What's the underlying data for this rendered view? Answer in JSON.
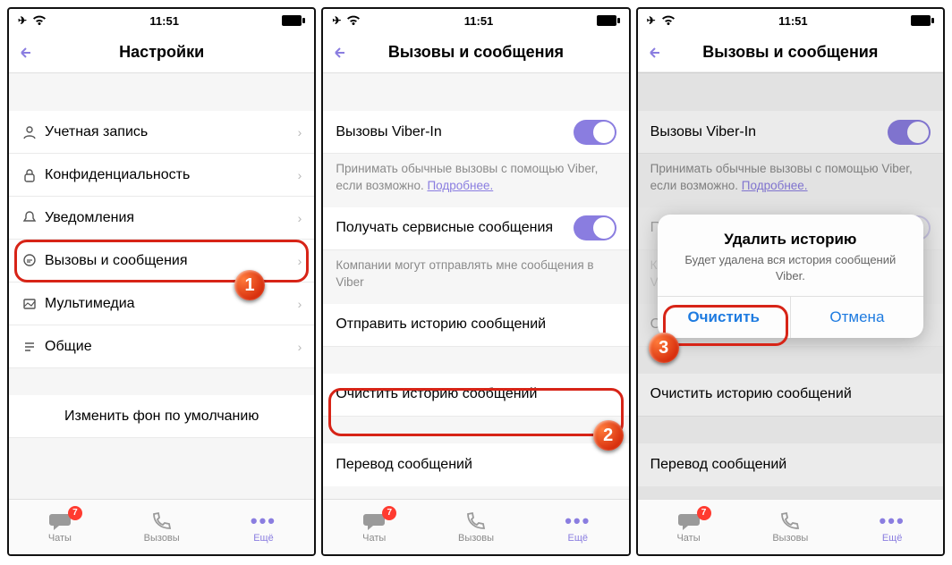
{
  "status": {
    "time": "11:51"
  },
  "screens": {
    "settings": {
      "title": "Настройки",
      "items": [
        {
          "icon": "user-icon",
          "label": "Учетная запись"
        },
        {
          "icon": "lock-icon",
          "label": "Конфиденциальность"
        },
        {
          "icon": "bell-icon",
          "label": "Уведомления"
        },
        {
          "icon": "chat-icon",
          "label": "Вызовы и сообщения"
        },
        {
          "icon": "image-icon",
          "label": "Мультимедиа"
        },
        {
          "icon": "list-icon",
          "label": "Общие"
        }
      ],
      "change_bg": "Изменить фон по умолчанию"
    },
    "calls": {
      "title": "Вызовы и сообщения",
      "viberin_label": "Вызовы Viber-In",
      "viberin_desc_a": "Принимать обычные вызовы с помощью Viber, если возможно. ",
      "viberin_desc_link": "Подробнее.",
      "service_label": "Получать сервисные сообщения",
      "service_desc": "Компании могут отправлять мне сообщения в Viber",
      "send_history": "Отправить историю сообщений",
      "clear_history": "Очистить историю сообщений",
      "translate": "Перевод сообщений"
    },
    "dialog": {
      "title": "Удалить историю",
      "message": "Будет удалена вся история сообщений Viber.",
      "confirm": "Очистить",
      "cancel": "Отмена"
    }
  },
  "tabbar": {
    "chats": "Чаты",
    "calls": "Вызовы",
    "more": "Ещё",
    "badge": "7"
  },
  "markers": {
    "one": "1",
    "two": "2",
    "three": "3"
  }
}
